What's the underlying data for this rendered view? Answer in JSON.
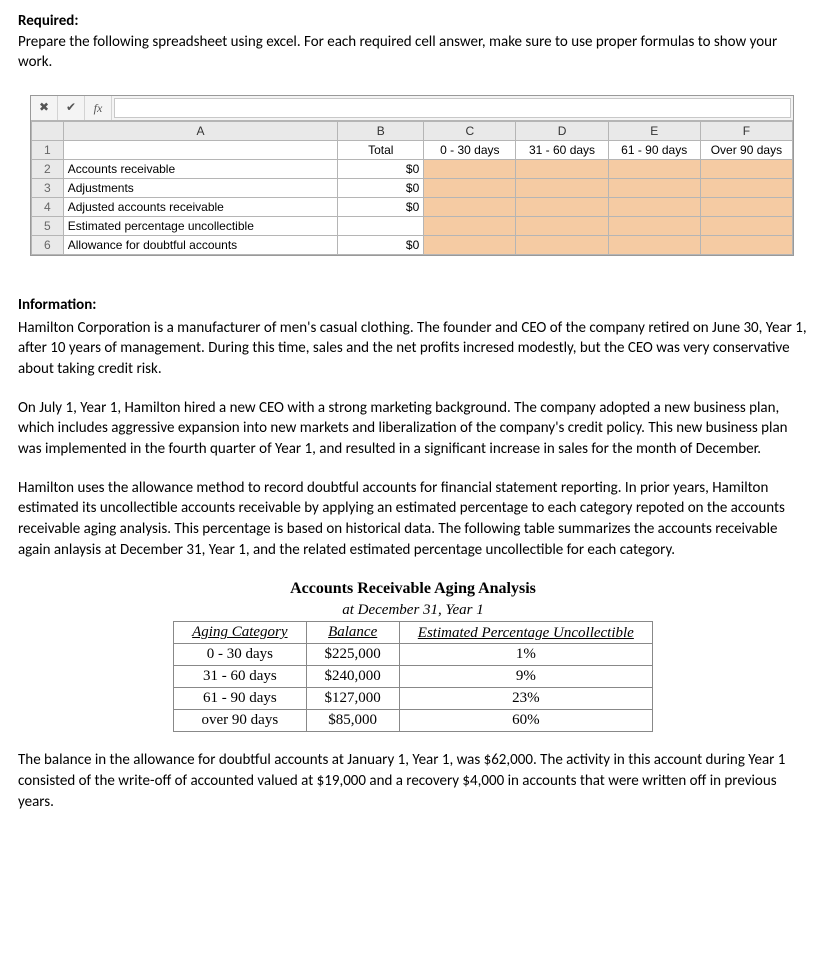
{
  "required": {
    "heading": "Required:",
    "text": "Prepare the following spreadsheet using excel. For each required cell answer, make sure to use proper formulas to show your work."
  },
  "sheet": {
    "fx_label": "fx",
    "cancel_glyph": "✖",
    "accept_glyph": "✔",
    "col_headers": {
      "A": "A",
      "B": "B",
      "C": "C",
      "D": "D",
      "E": "E",
      "F": "F"
    },
    "row1": {
      "n": "1",
      "B": "Total",
      "C": "0 - 30 days",
      "D": "31 - 60 days",
      "E": "61 - 90 days",
      "F": "Over 90 days"
    },
    "row2": {
      "n": "2",
      "A": "Accounts receivable",
      "B": "$0"
    },
    "row3": {
      "n": "3",
      "A": "Adjustments",
      "B": "$0"
    },
    "row4": {
      "n": "4",
      "A": "Adjusted accounts receivable",
      "B": "$0"
    },
    "row5": {
      "n": "5",
      "A": "Estimated percentage uncollectible"
    },
    "row6": {
      "n": "6",
      "A": "Allowance for doubtful accounts",
      "B": "$0"
    }
  },
  "information": {
    "heading": "Information:",
    "p1": "Hamilton Corporation is a manufacturer of men's casual clothing. The founder and CEO of the company retired on June 30, Year 1, after 10 years of management. During this time, sales and the net profits incresed modestly, but the CEO was very conservative about taking credit risk.",
    "p2": "On July 1, Year 1, Hamilton hired a new CEO with a strong marketing background. The company adopted a new business plan, which includes aggressive expansion into new markets and liberalization of the company's credit policy. This new business plan was implemented in the fourth quarter of Year 1, and resulted in a significant increase in sales for the month of December.",
    "p3": "Hamilton uses the allowance method to record doubtful accounts for financial statement reporting. In prior years, Hamilton estimated its uncollectible accounts receivable by applying an estimated percentage to each category repoted on the accounts receivable aging analysis. This percentage is based on historical data. The following table summarizes the accounts receivable again anlaysis at December 31, Year 1, and the related estimated percentage uncollectible for each category.",
    "p4": "The balance in the allowance for doubtful accounts at January 1, Year 1, was $62,000. The activity in this account during Year 1 consisted of the write-off of accounted valued at $19,000 and a recovery $4,000 in accounts that were written off in previous years."
  },
  "aging": {
    "title": "Accounts Receivable Aging Analysis",
    "subtitle": "at December 31, Year 1",
    "headers": {
      "cat": "Aging Category",
      "bal": "Balance",
      "pct": "Estimated Percentage Uncollectible"
    },
    "rows": [
      {
        "cat": "0 - 30 days",
        "bal": "$225,000",
        "pct": "1%"
      },
      {
        "cat": "31 - 60 days",
        "bal": "$240,000",
        "pct": "9%"
      },
      {
        "cat": "61 - 90 days",
        "bal": "$127,000",
        "pct": "23%"
      },
      {
        "cat": "over 90 days",
        "bal": "$85,000",
        "pct": "60%"
      }
    ]
  },
  "chart_data": {
    "type": "table",
    "title": "Accounts Receivable Aging Analysis at December 31, Year 1",
    "columns": [
      "Aging Category",
      "Balance",
      "Estimated Percentage Uncollectible"
    ],
    "categories": [
      "0 - 30 days",
      "31 - 60 days",
      "61 - 90 days",
      "over 90 days"
    ],
    "series": [
      {
        "name": "Balance",
        "values": [
          225000,
          240000,
          127000,
          85000
        ]
      },
      {
        "name": "Estimated Percentage Uncollectible",
        "values": [
          0.01,
          0.09,
          0.23,
          0.6
        ]
      }
    ]
  }
}
